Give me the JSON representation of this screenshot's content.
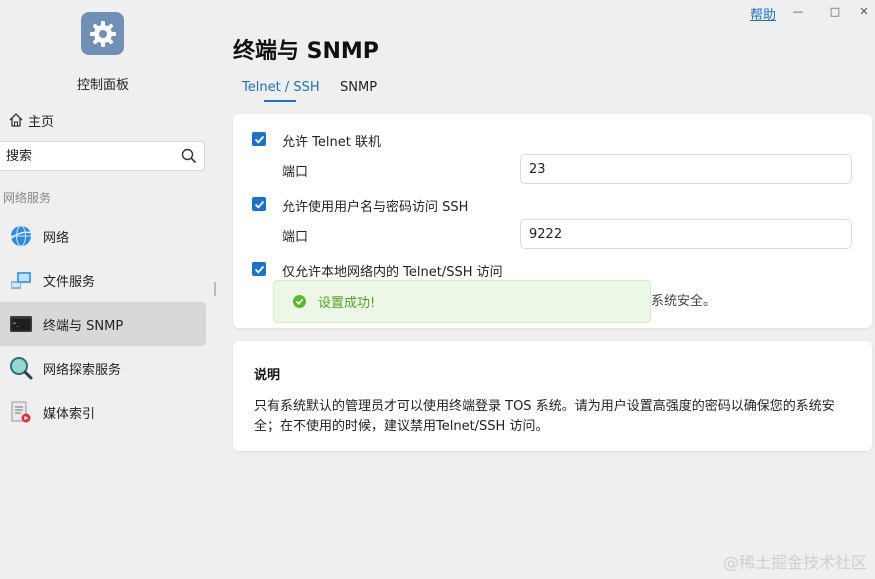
{
  "sidebar": {
    "app_title": "控制面板",
    "home_label": "主页",
    "search_placeholder": "搜索",
    "section_label": "网络服务",
    "items": [
      {
        "label": "网络",
        "icon": "globe-icon"
      },
      {
        "label": "文件服务",
        "icon": "file-service-icon"
      },
      {
        "label": "终端与 SNMP",
        "icon": "terminal-icon",
        "active": true
      },
      {
        "label": "网络探索服务",
        "icon": "magnifier-icon"
      },
      {
        "label": "媒体索引",
        "icon": "media-index-icon"
      }
    ]
  },
  "window": {
    "help_label": "帮助",
    "minimize": "—",
    "maximize": "□",
    "close": "✕"
  },
  "main": {
    "title": "终端与 SNMP",
    "tabs": [
      {
        "label": "Telnet / SSH",
        "active": true
      },
      {
        "label": "SNMP",
        "active": false
      }
    ],
    "settings": {
      "telnet_label": "允许 Telnet 联机",
      "telnet_checked": true,
      "telnet_port_label": "端口",
      "telnet_port_value": "23",
      "ssh_label": "允许使用用户名与密码访问 SSH",
      "ssh_checked": true,
      "ssh_port_label": "端口",
      "ssh_port_value": "9222",
      "local_only_label": "仅允许本地网络内的 Telnet/SSH 访问",
      "local_only_checked": true,
      "obscured_text": "系统安全。"
    },
    "toast": "设置成功!",
    "description": {
      "title": "说明",
      "text": "只有系统默认的管理员才可以使用终端登录 TOS 系统。请为用户设置高强度的密码以确保您的系统安全；在不使用的时候，建议禁用Telnet/SSH 访问。"
    }
  },
  "watermark": "@稀土掘金技术社区",
  "colors": {
    "accent": "#1a73c8",
    "success": "#5cb82e",
    "background": "#efefef"
  }
}
